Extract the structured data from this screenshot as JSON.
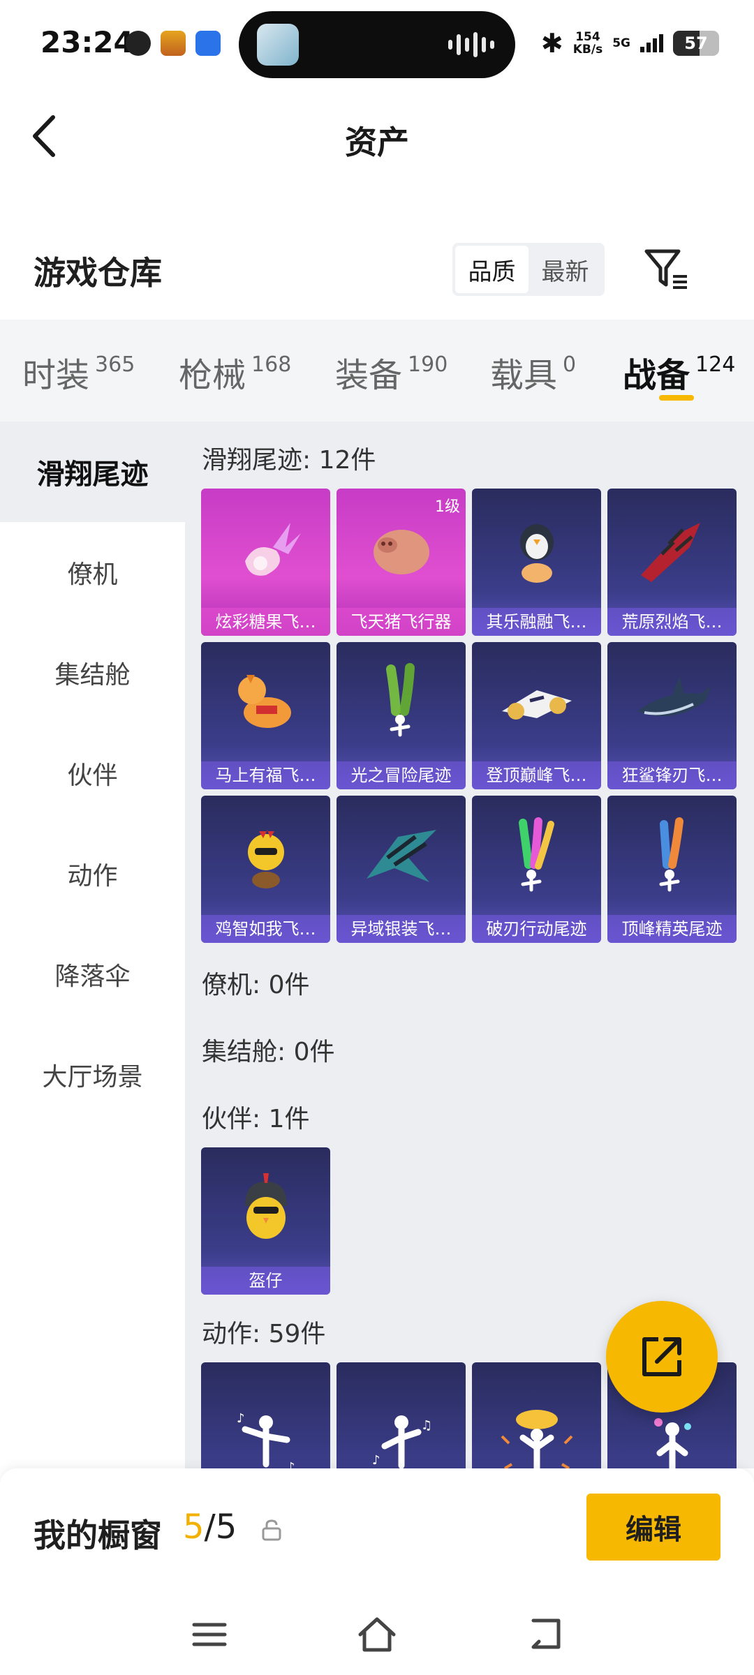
{
  "status_bar": {
    "time": "23:24",
    "net_speed_value": "154",
    "net_speed_unit": "KB/s",
    "network": "5G",
    "battery": "57",
    "battery_level": 0.57
  },
  "header": {
    "title": "资产"
  },
  "warehouse": {
    "title": "游戏仓库",
    "sort_options": [
      "品质",
      "最新"
    ],
    "sort_selected": "品质"
  },
  "tabs": [
    {
      "label": "时装",
      "count": "365"
    },
    {
      "label": "枪械",
      "count": "168"
    },
    {
      "label": "装备",
      "count": "190"
    },
    {
      "label": "载具",
      "count": "0"
    },
    {
      "label": "战备",
      "count": "124",
      "active": true
    }
  ],
  "sidebar": {
    "items": [
      "滑翔尾迹",
      "僚机",
      "集结舱",
      "伙伴",
      "动作",
      "降落伞",
      "大厅场景"
    ],
    "active": "滑翔尾迹"
  },
  "sections": {
    "glide": {
      "title": "滑翔尾迹: 12件",
      "items": [
        {
          "label": "炫彩糖果飞…",
          "style": "pink",
          "icon": "candy-glider"
        },
        {
          "label": "飞天猪飞行器",
          "style": "pink",
          "icon": "flying-pig",
          "level": "1级"
        },
        {
          "label": "其乐融融飞…",
          "style": "purple",
          "icon": "penguin-glider"
        },
        {
          "label": "荒原烈焰飞…",
          "style": "purple",
          "icon": "flame-glider"
        },
        {
          "label": "马上有福飞…",
          "style": "purple",
          "icon": "horse-glider"
        },
        {
          "label": "光之冒险尾迹",
          "style": "purple",
          "icon": "green-trail"
        },
        {
          "label": "登顶巅峰飞…",
          "style": "purple",
          "icon": "jet-glider"
        },
        {
          "label": "狂鲨锋刃飞…",
          "style": "purple",
          "icon": "shark-glider"
        },
        {
          "label": "鸡智如我飞…",
          "style": "purple",
          "icon": "chicken-glider"
        },
        {
          "label": "异域银装飞…",
          "style": "purple",
          "icon": "wing-glider"
        },
        {
          "label": "破刃行动尾迹",
          "style": "purple",
          "icon": "rainbow-trail"
        },
        {
          "label": "顶峰精英尾迹",
          "style": "purple",
          "icon": "fire-trail"
        }
      ]
    },
    "wingman": {
      "title": "僚机: 0件"
    },
    "assembly": {
      "title": "集结舱: 0件"
    },
    "partner": {
      "title": "伙伴: 1件",
      "items": [
        {
          "label": "盔仔",
          "style": "purple",
          "icon": "helmet-chick"
        }
      ]
    },
    "emote": {
      "title": "动作: 59件",
      "items": [
        {
          "icon": "dance-emote"
        },
        {
          "icon": "music-emote"
        },
        {
          "icon": "explosion-emote"
        },
        {
          "icon": "sparkle-emote"
        }
      ]
    }
  },
  "bottom": {
    "showcase_label": "我的橱窗",
    "showcase_current": "5",
    "showcase_total": "/5",
    "edit_label": "编辑"
  },
  "colors": {
    "accent": "#f6b800",
    "card_purple": "#3b3d8a",
    "card_pink": "#e04fd0"
  }
}
